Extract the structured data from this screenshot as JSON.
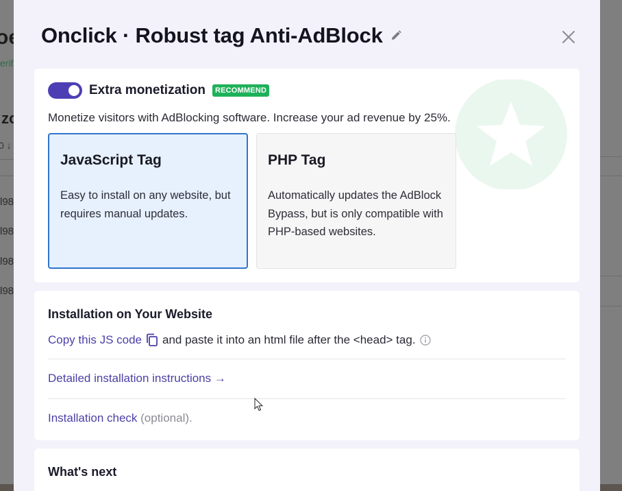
{
  "background": {
    "title_fragment": "oe",
    "verify_fragment": "erifi",
    "zone_fragment": "zo",
    "sort_fragment": "0 ↓",
    "rows": [
      "l98",
      "l98",
      "l98",
      "l98"
    ]
  },
  "modal": {
    "title": "Onclick · Robust tag Anti-AdBlock",
    "edit_icon": "pencil-icon",
    "close_icon": "close-icon"
  },
  "monetization": {
    "toggle_on": true,
    "label": "Extra monetization",
    "badge": "RECOMMEND",
    "description": "Monetize visitors with AdBlocking software. Increase your ad revenue by 25%.",
    "options": [
      {
        "title": "JavaScript Tag",
        "description": "Easy to install on any website, but requires manual updates.",
        "selected": true
      },
      {
        "title": "PHP Tag",
        "description": "Automatically updates the AdBlock Bypass, but is only compatible with PHP-based websites.",
        "selected": false
      }
    ]
  },
  "installation": {
    "title": "Installation on Your Website",
    "copy_link": "Copy this JS code",
    "copy_rest": "and paste it into an html file after the <head> tag.",
    "detail_link": "Detailed installation instructions →",
    "check_link": "Installation check",
    "check_suffix": "(optional)."
  },
  "next": {
    "title": "What's next"
  },
  "colors": {
    "accent": "#4b3fa6",
    "toggle": "#4d3fb3",
    "badge": "#1fb15a",
    "selected_border": "#2f74d0",
    "selected_bg": "#e6f1fd"
  }
}
